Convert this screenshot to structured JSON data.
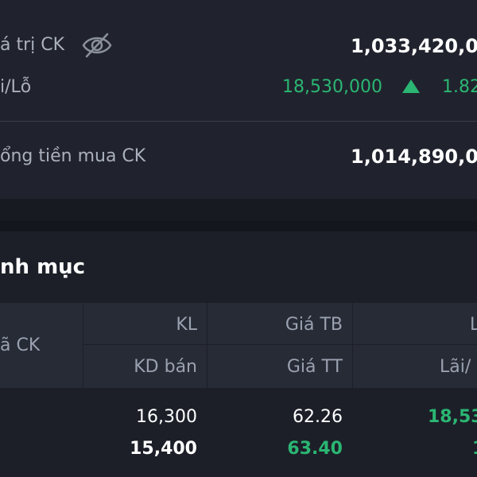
{
  "summary": {
    "market_value_label": "á trị CK",
    "market_value": "1,033,420,00",
    "pl_label": "i/Lỗ",
    "pl_value": "18,530,000",
    "pl_percent": "1.82",
    "buy_total_label": "ổng tiền mua CK",
    "buy_total_value": "1,014,890,00",
    "colors": {
      "up": "#2bb673",
      "card": "#20232d"
    }
  },
  "portfolio": {
    "title": "nh mục",
    "columns": {
      "symbol": "ã CK",
      "qty": "KL",
      "sellable": "KD bán",
      "avg_price": "Giá TB",
      "market_price": "Giá TT",
      "pl_top": "L",
      "pl": "Lãi/"
    },
    "rows": [
      {
        "qty": "16,300",
        "sellable": "15,400",
        "avg_price": "62.26",
        "market_price": "63.40",
        "pl_value": "18,53",
        "pl_pct": "1"
      }
    ]
  }
}
